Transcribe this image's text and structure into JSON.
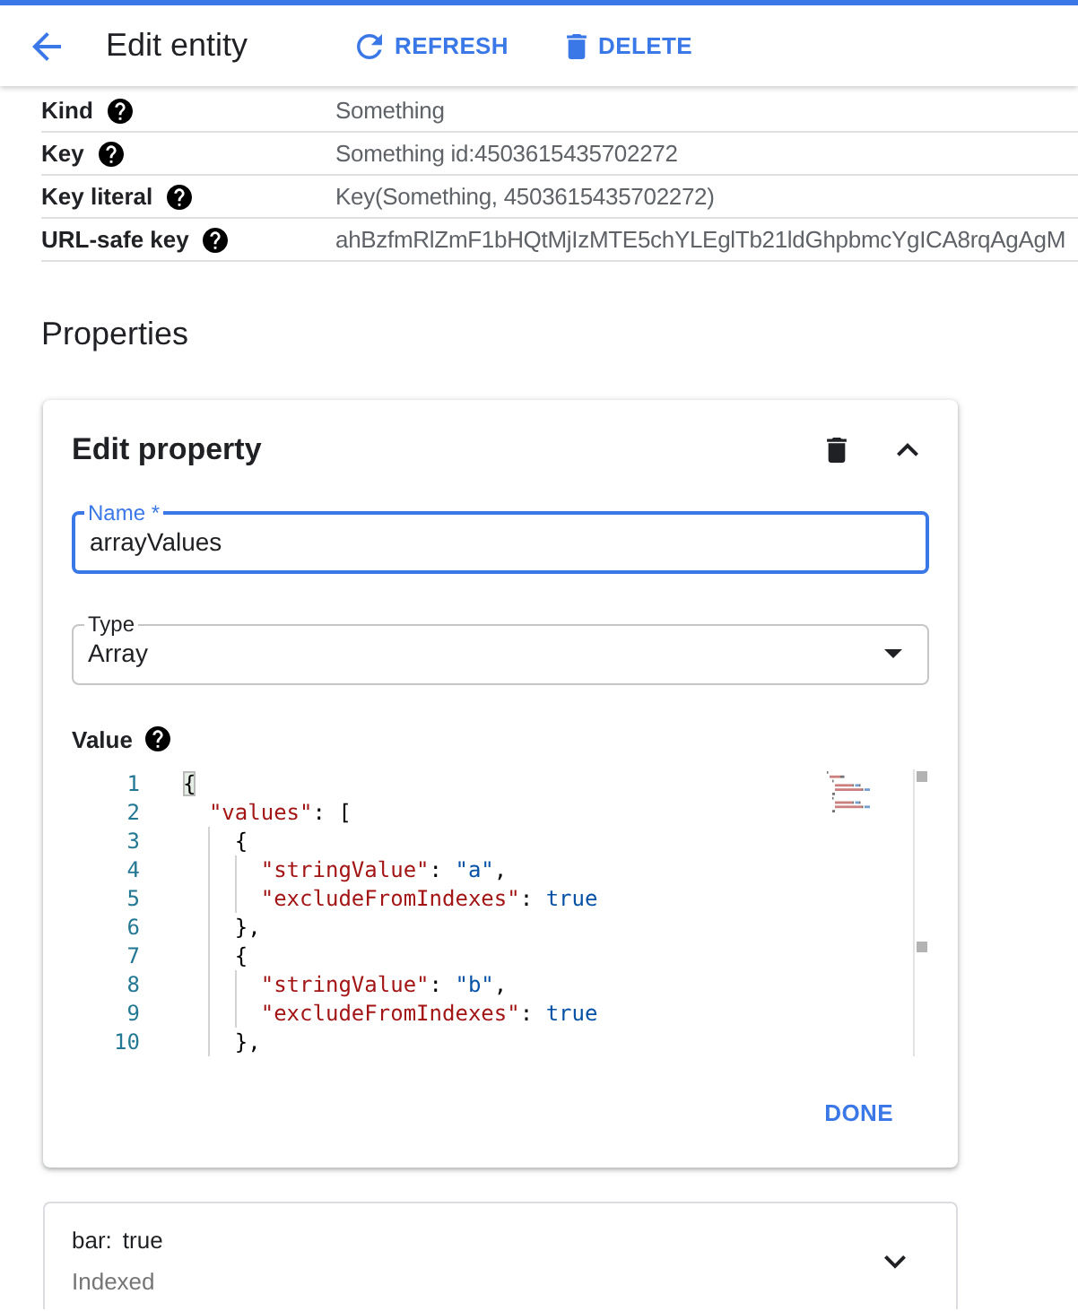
{
  "header": {
    "title": "Edit entity",
    "actions": [
      {
        "kind": "refresh",
        "label": "REFRESH"
      },
      {
        "kind": "delete",
        "label": "DELETE"
      }
    ]
  },
  "key_table": {
    "rows": [
      {
        "label": "Kind",
        "value": "Something"
      },
      {
        "label": "Key",
        "value": "Something id:4503615435702272"
      },
      {
        "label": "Key literal",
        "value": "Key(Something, 4503615435702272)"
      },
      {
        "label": "URL-safe key",
        "value": "ahBzfmRlZmF1bHQtMjIzMTE5chYLEglTb21ldGhpbmcYgICA8rqAgAgM"
      }
    ]
  },
  "properties": {
    "title": "Properties",
    "editor": {
      "title": "Edit property",
      "expanded": true,
      "name_field": {
        "label": "Name *",
        "value": "arrayValues",
        "focused": true
      },
      "type_field": {
        "label": "Type",
        "value": "Array"
      },
      "value_label": "Value",
      "code_lines": [
        {
          "number": "1",
          "tokens": [
            {
              "kind": "punct",
              "text": "{",
              "highlighted": true
            }
          ]
        },
        {
          "number": "2",
          "tokens": [
            {
              "kind": "key",
              "text": "  \"values\"",
              "highlighted": false
            },
            {
              "kind": "punct",
              "text": ": [",
              "highlighted": false
            }
          ]
        },
        {
          "number": "3",
          "tokens": [
            {
              "kind": "punct",
              "text": "    {",
              "highlighted": false
            }
          ]
        },
        {
          "number": "4",
          "tokens": [
            {
              "kind": "key",
              "text": "      \"stringValue\"",
              "highlighted": false
            },
            {
              "kind": "punct",
              "text": ": ",
              "highlighted": false
            },
            {
              "kind": "string",
              "text": "\"a\"",
              "highlighted": false
            },
            {
              "kind": "punct",
              "text": ",",
              "highlighted": false
            }
          ]
        },
        {
          "number": "5",
          "tokens": [
            {
              "kind": "key",
              "text": "      \"excludeFromIndexes\"",
              "highlighted": false
            },
            {
              "kind": "punct",
              "text": ": ",
              "highlighted": false
            },
            {
              "kind": "literal",
              "text": "true",
              "highlighted": false
            }
          ]
        },
        {
          "number": "6",
          "tokens": [
            {
              "kind": "punct",
              "text": "    },",
              "highlighted": false
            }
          ]
        },
        {
          "number": "7",
          "tokens": [
            {
              "kind": "punct",
              "text": "    {",
              "highlighted": false
            }
          ]
        },
        {
          "number": "8",
          "tokens": [
            {
              "kind": "key",
              "text": "      \"stringValue\"",
              "highlighted": false
            },
            {
              "kind": "punct",
              "text": ": ",
              "highlighted": false
            },
            {
              "kind": "string",
              "text": "\"b\"",
              "highlighted": false
            },
            {
              "kind": "punct",
              "text": ",",
              "highlighted": false
            }
          ]
        },
        {
          "number": "9",
          "tokens": [
            {
              "kind": "key",
              "text": "      \"excludeFromIndexes\"",
              "highlighted": false
            },
            {
              "kind": "punct",
              "text": ": ",
              "highlighted": false
            },
            {
              "kind": "literal",
              "text": "true",
              "highlighted": false
            }
          ]
        },
        {
          "number": "10",
          "tokens": [
            {
              "kind": "punct",
              "text": "    },",
              "highlighted": false
            }
          ]
        }
      ],
      "done_button": "DONE"
    },
    "items": [
      {
        "name": "bar:",
        "value": "true",
        "note": "Indexed",
        "expanded": false
      }
    ]
  }
}
